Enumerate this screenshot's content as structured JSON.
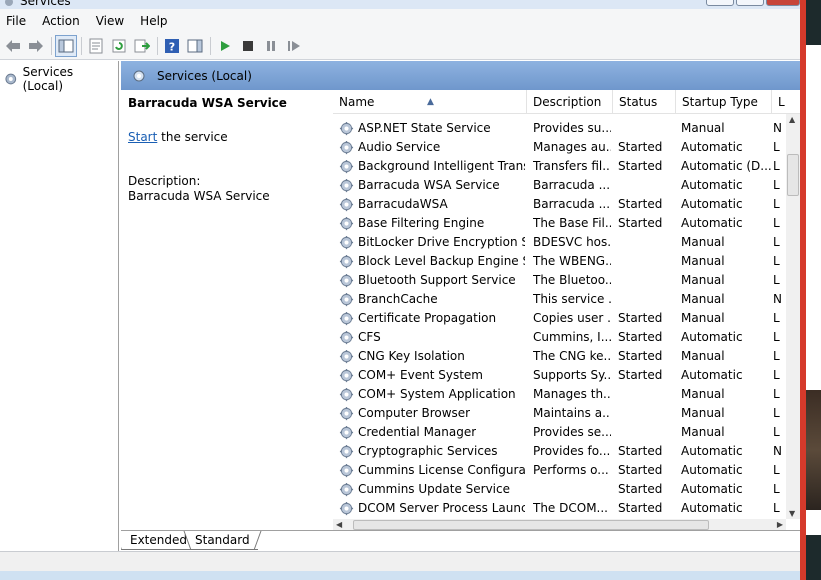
{
  "window": {
    "title": "Services",
    "buttons": [
      "minimize",
      "maximize",
      "close"
    ]
  },
  "menu": [
    "File",
    "Action",
    "View",
    "Help"
  ],
  "toolbar": {
    "icons": [
      "back-icon",
      "forward-icon",
      "show-hide-console-tree-icon",
      "properties-icon",
      "refresh-icon",
      "export-list-icon",
      "help-icon",
      "show-action-pane-icon",
      "start-service-icon",
      "stop-service-icon",
      "pause-service-icon",
      "restart-service-icon"
    ]
  },
  "tree": {
    "root_label": "Services (Local)"
  },
  "panel": {
    "header": "Services (Local)",
    "service_title": "Barracuda WSA Service",
    "start_link": "Start",
    "start_rest": " the service",
    "description_label": "Description:",
    "description_value": "Barracuda WSA Service"
  },
  "columns": [
    "Name",
    "Description",
    "Status",
    "Startup Type",
    "L"
  ],
  "rows": [
    {
      "name": "ASP.NET State Service",
      "desc": "Provides su...",
      "status": "",
      "startup": "Manual",
      "log": "N"
    },
    {
      "name": "Audio Service",
      "desc": "Manages au...",
      "status": "Started",
      "startup": "Automatic",
      "log": "L"
    },
    {
      "name": "Background Intelligent Transf...",
      "desc": "Transfers fil...",
      "status": "Started",
      "startup": "Automatic (D...",
      "log": "L"
    },
    {
      "name": "Barracuda WSA Service",
      "desc": "Barracuda ...",
      "status": "",
      "startup": "Automatic",
      "log": "L"
    },
    {
      "name": "BarracudaWSA",
      "desc": "Barracuda ...",
      "status": "Started",
      "startup": "Automatic",
      "log": "L"
    },
    {
      "name": "Base Filtering Engine",
      "desc": "The Base Fil...",
      "status": "Started",
      "startup": "Automatic",
      "log": "L"
    },
    {
      "name": "BitLocker Drive Encryption Ser...",
      "desc": "BDESVC hos...",
      "status": "",
      "startup": "Manual",
      "log": "L"
    },
    {
      "name": "Block Level Backup Engine Ser...",
      "desc": "The WBENG...",
      "status": "",
      "startup": "Manual",
      "log": "L"
    },
    {
      "name": "Bluetooth Support Service",
      "desc": "The Bluetoo...",
      "status": "",
      "startup": "Manual",
      "log": "L"
    },
    {
      "name": "BranchCache",
      "desc": "This service ...",
      "status": "",
      "startup": "Manual",
      "log": "N"
    },
    {
      "name": "Certificate Propagation",
      "desc": "Copies user ...",
      "status": "Started",
      "startup": "Manual",
      "log": "L"
    },
    {
      "name": "CFS",
      "desc": "Cummins, I...",
      "status": "Started",
      "startup": "Automatic",
      "log": "L"
    },
    {
      "name": "CNG Key Isolation",
      "desc": "The CNG ke...",
      "status": "Started",
      "startup": "Manual",
      "log": "L"
    },
    {
      "name": "COM+ Event System",
      "desc": "Supports Sy...",
      "status": "Started",
      "startup": "Automatic",
      "log": "L"
    },
    {
      "name": "COM+ System Application",
      "desc": "Manages th...",
      "status": "",
      "startup": "Manual",
      "log": "L"
    },
    {
      "name": "Computer Browser",
      "desc": "Maintains a...",
      "status": "",
      "startup": "Manual",
      "log": "L"
    },
    {
      "name": "Credential Manager",
      "desc": "Provides se...",
      "status": "",
      "startup": "Manual",
      "log": "L"
    },
    {
      "name": "Cryptographic Services",
      "desc": "Provides fo...",
      "status": "Started",
      "startup": "Automatic",
      "log": "N"
    },
    {
      "name": "Cummins License Configurati...",
      "desc": "Performs o...",
      "status": "Started",
      "startup": "Automatic",
      "log": "L"
    },
    {
      "name": "Cummins Update Service",
      "desc": "",
      "status": "Started",
      "startup": "Automatic",
      "log": "L"
    },
    {
      "name": "DCOM Server Process Launcher",
      "desc": "The DCOM...",
      "status": "Started",
      "startup": "Automatic",
      "log": "L"
    }
  ],
  "tabs": [
    "Extended",
    "Standard"
  ],
  "colors": {
    "header_gradient_top": "#8eb2e0",
    "header_gradient_bottom": "#6f97cc",
    "link": "#1a5fb4",
    "play_green": "#2e9e3e"
  }
}
